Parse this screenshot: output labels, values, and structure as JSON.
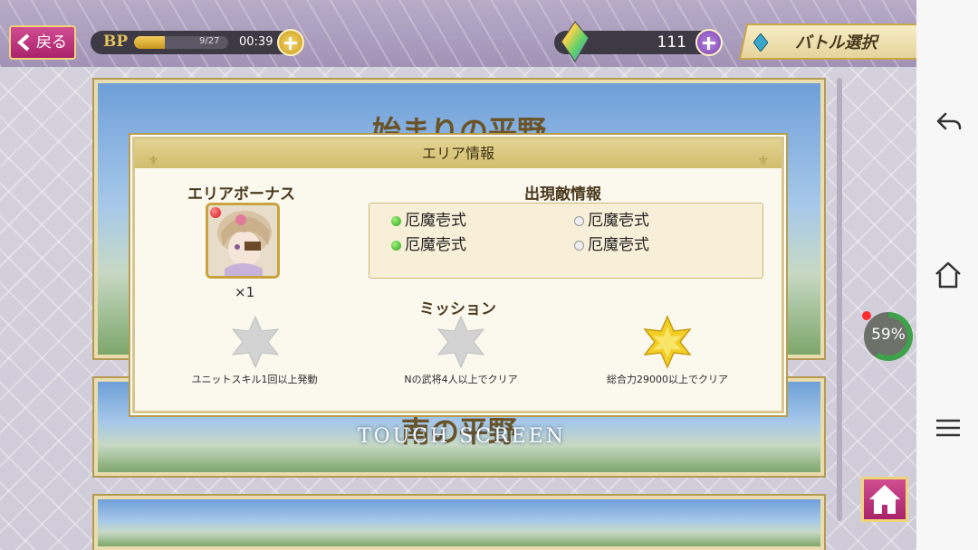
{
  "header": {
    "back_label": "戻る",
    "bp_label": "BP",
    "bp_count": "9/27",
    "bp_fraction": 0.33,
    "bp_timer": "00:39",
    "gem_count": "111",
    "battle_select_label": "バトル選択"
  },
  "stages": [
    {
      "title": "始まりの平野"
    },
    {
      "title": "南の平野"
    },
    {
      "title": ""
    }
  ],
  "touch_screen": "TOUCH SCREEN",
  "modal": {
    "title": "エリア情報",
    "area_bonus_title": "エリアボーナス",
    "bonus_multiplier": "×1",
    "enemy_info_title": "出現敵情報",
    "enemies": [
      {
        "name": "厄魔壱式",
        "status": "on"
      },
      {
        "name": "厄魔壱式",
        "status": "off"
      },
      {
        "name": "厄魔壱式",
        "status": "on"
      },
      {
        "name": "厄魔壱式",
        "status": "off"
      }
    ],
    "mission_title": "ミッション",
    "missions": [
      {
        "text": "ユニットスキル1回以上発動",
        "achieved": false
      },
      {
        "text": "Nの武将4人以上でクリア",
        "achieved": false
      },
      {
        "text": "総合力29000以上でクリア",
        "achieved": true
      }
    ]
  },
  "overlay": {
    "perf_percent": "59%"
  },
  "colors": {
    "accent_pink": "#c03a82",
    "gold": "#d2bd6d",
    "star_gold": "#f2c81f",
    "star_grey": "#cfcfcf"
  }
}
